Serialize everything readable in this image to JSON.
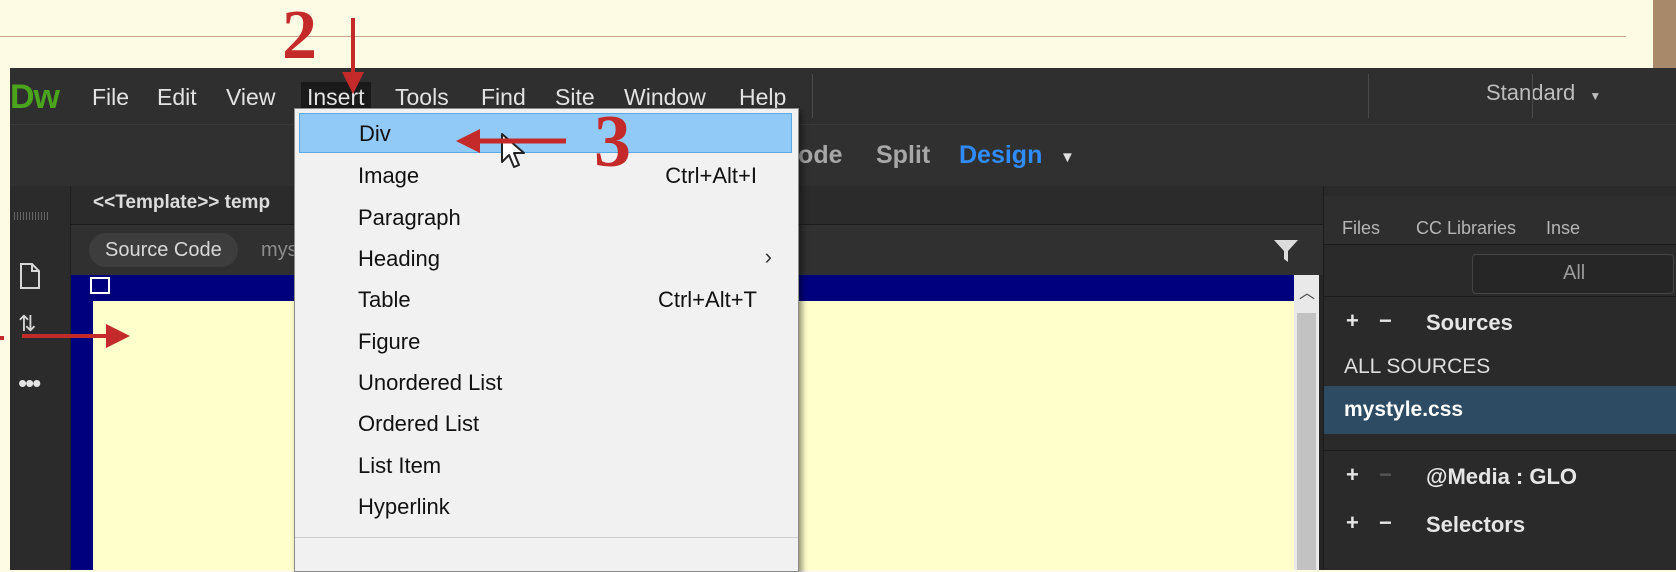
{
  "app": {
    "logo": "Dw",
    "menu": [
      "File",
      "Edit",
      "View",
      "Insert",
      "Tools",
      "Find",
      "Site",
      "Window",
      "Help"
    ],
    "active_menu": "Insert",
    "workspace": "Standard"
  },
  "view_switcher": {
    "code": "Code",
    "split": "Split",
    "design": "Design"
  },
  "document": {
    "tab": "<<Template>> temp",
    "source_code": "Source Code",
    "related_file": "mys"
  },
  "right_panel": {
    "tabs": [
      "Files",
      "CC Libraries",
      "Inse"
    ],
    "filter": "All",
    "sources_header": "Sources",
    "all_sources": "ALL SOURCES",
    "selected_source": "mystyle.css",
    "media_header": "@Media : GLO",
    "selectors_header": "Selectors"
  },
  "insert_menu": {
    "items": [
      {
        "label": "Div",
        "shortcut": "",
        "submenu": false
      },
      {
        "label": "Image",
        "shortcut": "Ctrl+Alt+I",
        "submenu": false
      },
      {
        "label": "Paragraph",
        "shortcut": "",
        "submenu": false
      },
      {
        "label": "Heading",
        "shortcut": "",
        "submenu": true
      },
      {
        "label": "Table",
        "shortcut": "Ctrl+Alt+T",
        "submenu": false
      },
      {
        "label": "Figure",
        "shortcut": "",
        "submenu": false
      },
      {
        "label": "Unordered List",
        "shortcut": "",
        "submenu": false
      },
      {
        "label": "Ordered List",
        "shortcut": "",
        "submenu": false
      },
      {
        "label": "List Item",
        "shortcut": "",
        "submenu": false
      },
      {
        "label": "Hyperlink",
        "shortcut": "",
        "submenu": false
      }
    ],
    "highlighted": "Div"
  },
  "annotations": {
    "step2": "2",
    "step3": "3"
  },
  "colors": {
    "annotation_red": "#c42a2a",
    "highlight": "#91c9f7",
    "dw_green": "#4aa51c",
    "design_blue": "#2f8cff"
  }
}
